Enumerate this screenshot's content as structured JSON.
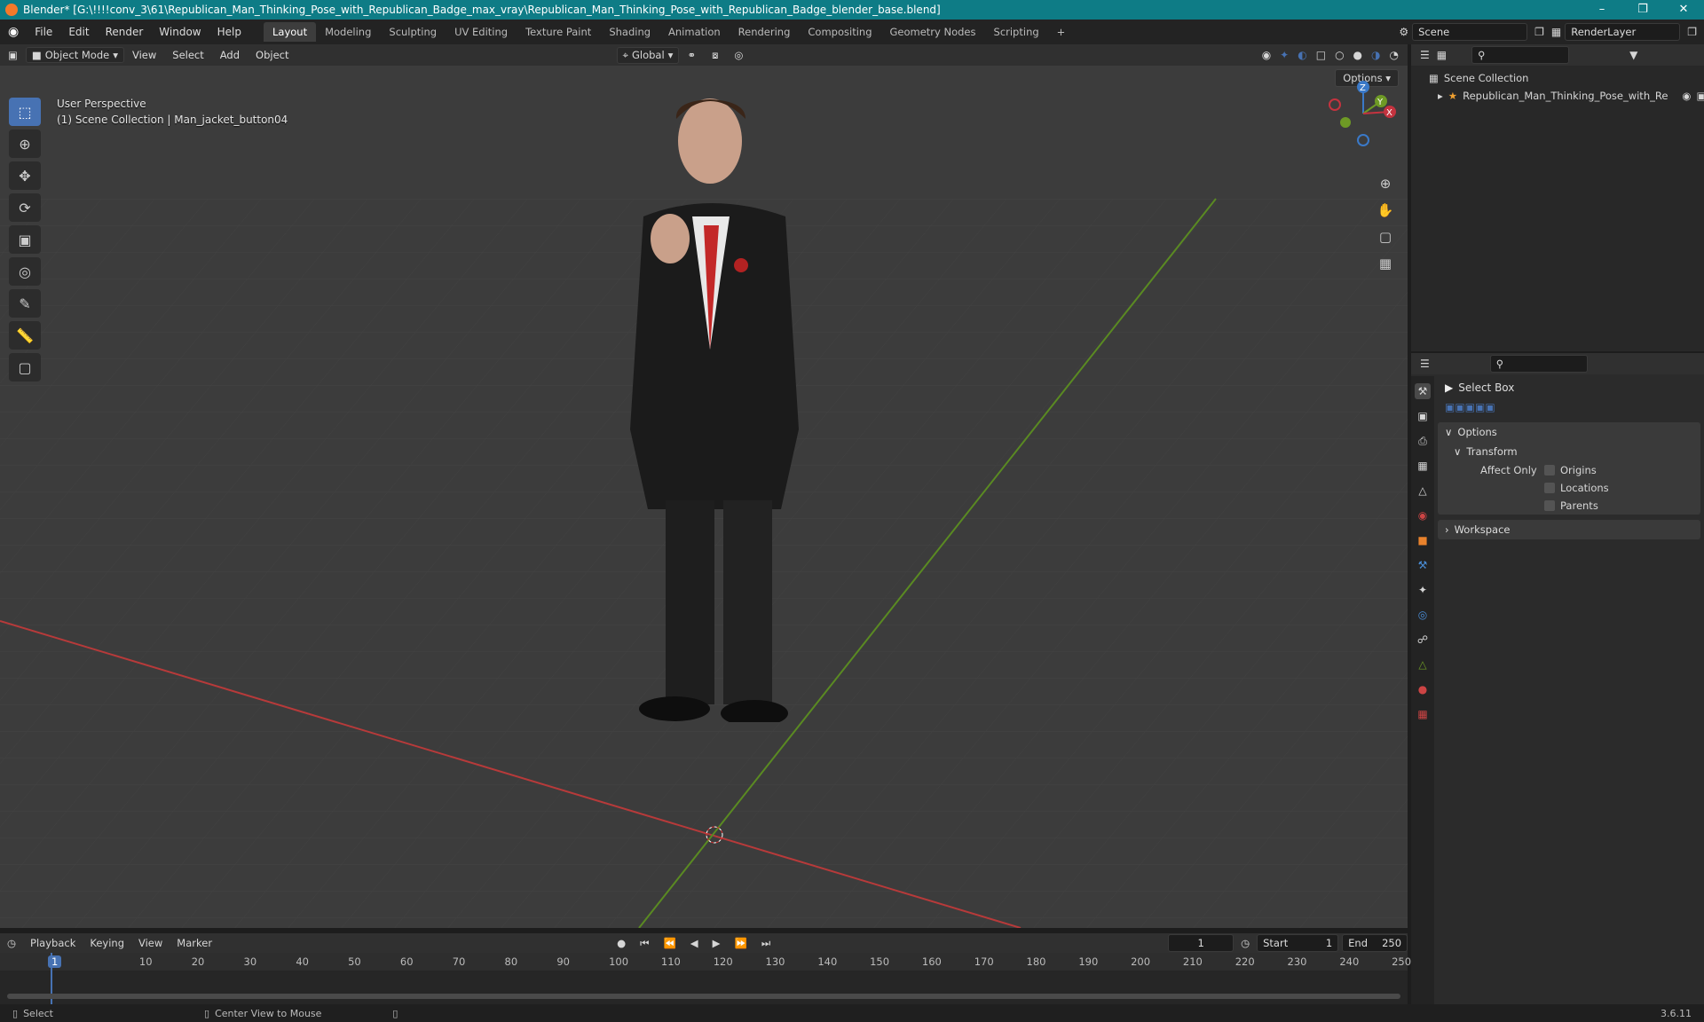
{
  "title": "Blender* [G:\\!!!!conv_3\\61\\Republican_Man_Thinking_Pose_with_Republican_Badge_max_vray\\Republican_Man_Thinking_Pose_with_Republican_Badge_blender_base.blend]",
  "menus": [
    "File",
    "Edit",
    "Render",
    "Window",
    "Help"
  ],
  "workspaces": [
    "Layout",
    "Modeling",
    "Sculpting",
    "UV Editing",
    "Texture Paint",
    "Shading",
    "Animation",
    "Rendering",
    "Compositing",
    "Geometry Nodes",
    "Scripting"
  ],
  "active_workspace": "Layout",
  "scene": "Scene",
  "render_layer": "RenderLayer",
  "viewport_header": {
    "mode": "Object Mode",
    "menus": [
      "View",
      "Select",
      "Add",
      "Object"
    ],
    "orientation": "Global",
    "options": "Options"
  },
  "overlay": {
    "line1": "User Perspective",
    "line2": "(1) Scene Collection | Man_jacket_button04"
  },
  "gizmo": {
    "z": "Z",
    "y": "Y",
    "x": "X"
  },
  "outliner": {
    "root": "Scene Collection",
    "item": "Republican_Man_Thinking_Pose_with_Re"
  },
  "properties": {
    "tool": "Select Box",
    "options": "Options",
    "transform": "Transform",
    "affect_only": "Affect Only",
    "checks": [
      "Origins",
      "Locations",
      "Parents"
    ],
    "workspace": "Workspace"
  },
  "timeline": {
    "menus": [
      "Playback",
      "Keying",
      "View",
      "Marker"
    ],
    "current_frame": "1",
    "start_label": "Start",
    "start": "1",
    "end_label": "End",
    "end": "250",
    "ticks": [
      "1",
      "10",
      "20",
      "30",
      "40",
      "50",
      "60",
      "70",
      "80",
      "90",
      "100",
      "110",
      "120",
      "130",
      "140",
      "150",
      "160",
      "170",
      "180",
      "190",
      "200",
      "210",
      "220",
      "230",
      "240",
      "250"
    ]
  },
  "status": {
    "select": "Select",
    "center": "Center View to Mouse",
    "version": "3.6.11"
  },
  "colors": {
    "accent": "#4772b3",
    "title": "#0e7c86",
    "x_axis": "#c4333f",
    "y_axis": "#6e9a25",
    "z_axis": "#3a79c8"
  }
}
